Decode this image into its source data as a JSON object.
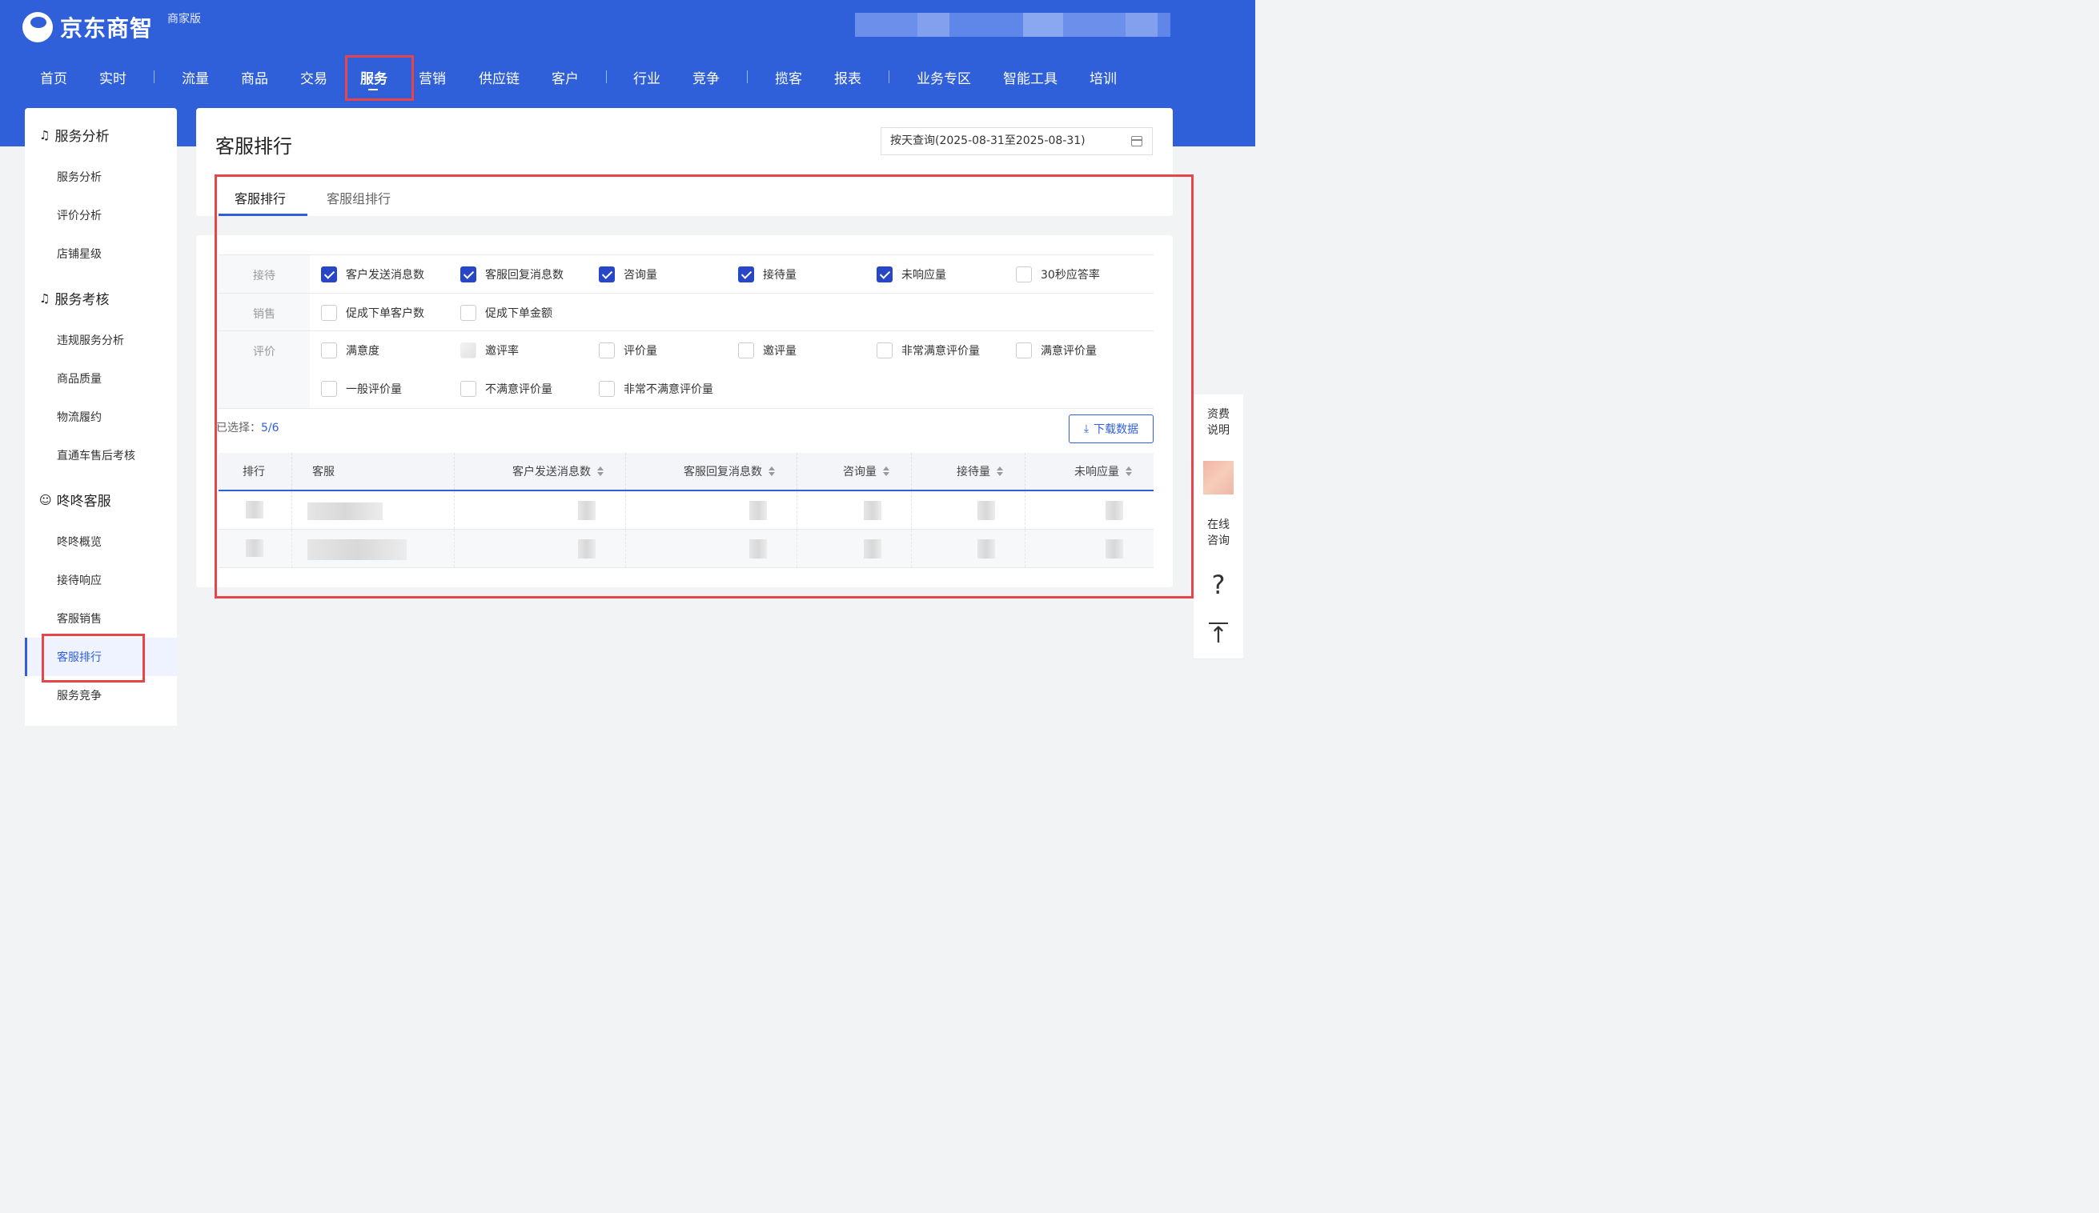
{
  "brand": {
    "name": "京东商智",
    "edition": "商家版"
  },
  "nav": [
    {
      "label": "首页"
    },
    {
      "label": "实时"
    },
    {
      "label": "流量"
    },
    {
      "label": "商品"
    },
    {
      "label": "交易"
    },
    {
      "label": "服务",
      "active": true
    },
    {
      "label": "营销"
    },
    {
      "label": "供应链"
    },
    {
      "label": "客户"
    },
    {
      "label": "行业"
    },
    {
      "label": "竞争"
    },
    {
      "label": "揽客"
    },
    {
      "label": "报表"
    },
    {
      "label": "业务专区"
    },
    {
      "label": "智能工具"
    },
    {
      "label": "培训"
    }
  ],
  "sidebar": {
    "groups": [
      {
        "title": "服务分析",
        "icon": "headset-icon",
        "items": [
          "服务分析",
          "评价分析",
          "店铺星级"
        ]
      },
      {
        "title": "服务考核",
        "icon": "headset-icon",
        "items": [
          "违规服务分析",
          "商品质量",
          "物流履约",
          "直通车售后考核"
        ]
      },
      {
        "title": "咚咚客服",
        "icon": "chat-icon",
        "items": [
          "咚咚概览",
          "接待响应",
          "客服销售",
          "客服排行",
          "服务竞争"
        ]
      }
    ],
    "active_item": "客服排行"
  },
  "page": {
    "title": "客服排行",
    "date_query": "按天查询(2025-08-31至2025-08-31)",
    "tabs": [
      {
        "label": "客服排行",
        "active": true
      },
      {
        "label": "客服组排行"
      }
    ]
  },
  "metrics": {
    "rows": [
      {
        "label": "接待",
        "items": [
          {
            "label": "客户发送消息数",
            "checked": true
          },
          {
            "label": "客服回复消息数",
            "checked": true
          },
          {
            "label": "咨询量",
            "checked": true
          },
          {
            "label": "接待量",
            "checked": true
          },
          {
            "label": "未响应量",
            "checked": true
          },
          {
            "label": "30秒应答率",
            "checked": false
          }
        ]
      },
      {
        "label": "销售",
        "items": [
          {
            "label": "促成下单客户数",
            "checked": false
          },
          {
            "label": "促成下单金额",
            "checked": false
          }
        ]
      },
      {
        "label": "评价",
        "items": [
          {
            "label": "满意度",
            "checked": false
          },
          {
            "label": "邀评率",
            "checked": false,
            "disabled": true
          },
          {
            "label": "评价量",
            "checked": false
          },
          {
            "label": "邀评量",
            "checked": false
          },
          {
            "label": "非常满意评价量",
            "checked": false
          },
          {
            "label": "满意评价量",
            "checked": false
          },
          {
            "label": "一般评价量",
            "checked": false
          },
          {
            "label": "不满意评价量",
            "checked": false
          },
          {
            "label": "非常不满意评价量",
            "checked": false
          }
        ]
      }
    ],
    "selected_label": "已选择：",
    "selected_count": "5/6",
    "download_label": "下载数据"
  },
  "table": {
    "columns": [
      {
        "label": "排行",
        "sortable": false
      },
      {
        "label": "客服",
        "sortable": false
      },
      {
        "label": "客户发送消息数",
        "sortable": true
      },
      {
        "label": "客服回复消息数",
        "sortable": true
      },
      {
        "label": "咨询量",
        "sortable": true
      },
      {
        "label": "接待量",
        "sortable": true
      },
      {
        "label": "未响应量",
        "sortable": true
      }
    ],
    "row_count": 2
  },
  "float_panel": {
    "fee_label": "资费\n说明",
    "consult_label": "在线\n咨询",
    "help_label": "?",
    "top_label": "↑"
  },
  "colors": {
    "primary": "#2f5fd9",
    "header_bg": "#2f5fd9",
    "highlight_red": "#e8454a",
    "checked": "#2746c8"
  }
}
